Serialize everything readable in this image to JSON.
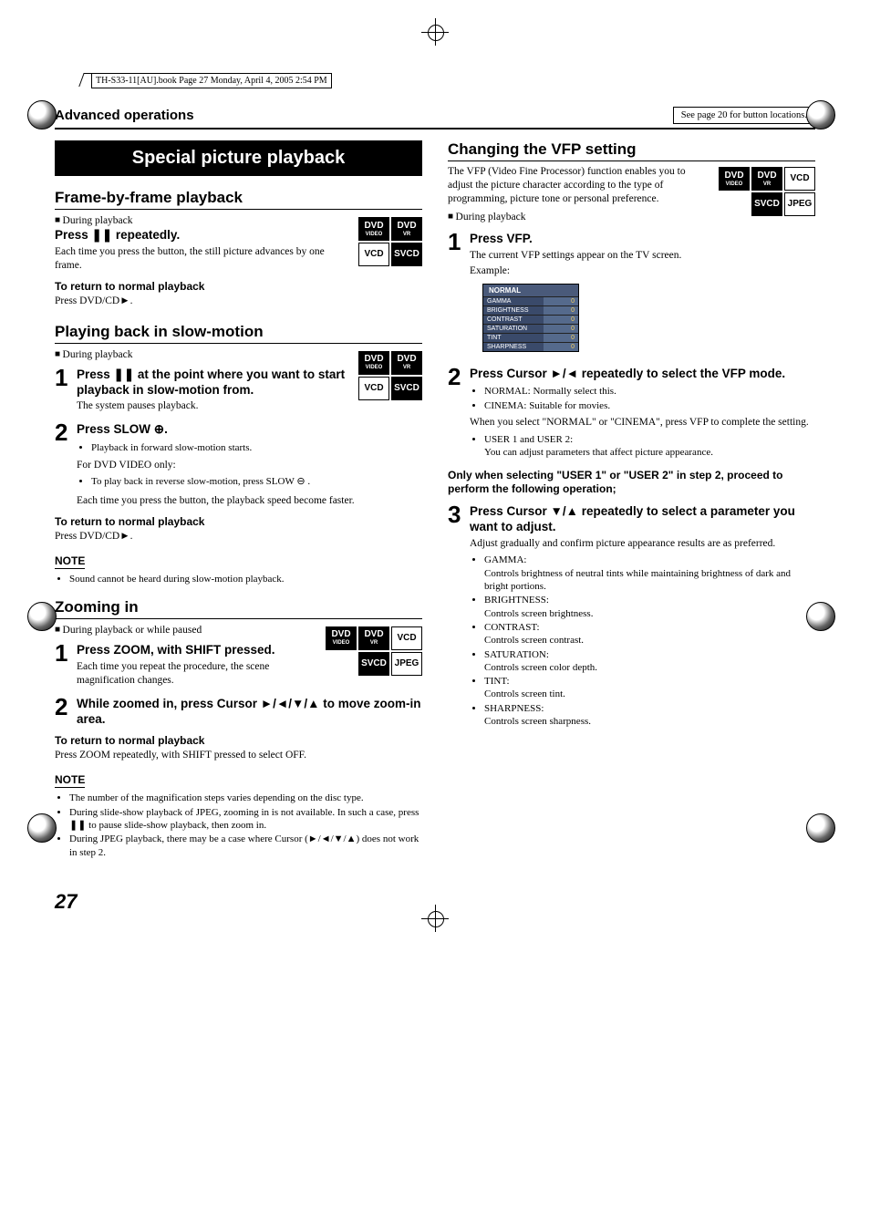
{
  "file_tag": "TH-S33-11[AU].book  Page 27  Monday, April 4, 2005  2:54 PM",
  "header": {
    "section": "Advanced operations",
    "button_note": "See page 20 for button locations."
  },
  "left": {
    "banner": "Special picture playback",
    "frame": {
      "title": "Frame-by-frame playback",
      "during": "During playback",
      "press_line": "Press ❚❚ repeatedly.",
      "desc": "Each time you press the button, the still picture advances by one frame.",
      "return_hd": "To return to normal playback",
      "return_body": "Press DVD/CD►.",
      "badges": [
        [
          "DVD",
          "VIDEO",
          "DVD",
          "VR"
        ],
        [
          "VCD",
          "",
          "SVCD",
          ""
        ]
      ]
    },
    "slow": {
      "title": "Playing back in slow-motion",
      "during": "During playback",
      "step1": "Press ❚❚ at the point where you want to start playback in slow-motion from.",
      "step1_sub": "The system pauses playback.",
      "step2": "Press SLOW ⊕.",
      "s2_b1": "Playback in forward slow-motion starts.",
      "s2_for": "For DVD VIDEO only:",
      "s2_b2": "To play back in reverse slow-motion, press SLOW ⊖ .",
      "s2_each": "Each time you press the button, the playback speed become faster.",
      "return_hd": "To return to normal playback",
      "return_body": "Press DVD/CD►.",
      "note_hd": "NOTE",
      "note1": "Sound cannot be heard during slow-motion playback.",
      "badges": [
        [
          "DVD",
          "VIDEO",
          "DVD",
          "VR"
        ],
        [
          "VCD",
          "",
          "SVCD",
          ""
        ]
      ]
    },
    "zoom": {
      "title": "Zooming in",
      "during": "During playback or while paused",
      "step1": "Press ZOOM, with SHIFT pressed.",
      "step1_sub": "Each time you repeat the procedure, the scene magnification changes.",
      "step2": "While zoomed in, press Cursor ►/◄/▼/▲ to move zoom-in area.",
      "return_hd": "To return to normal playback",
      "return_body": "Press ZOOM repeatedly, with SHIFT pressed to select OFF.",
      "note_hd": "NOTE",
      "note1": "The number of the magnification steps varies depending on the disc type.",
      "note2": "During slide-show playback of JPEG, zooming in is not available. In such a case, press ❚❚ to pause slide-show playback, then zoom in.",
      "note3": "During JPEG playback, there may be a case where Cursor (►/◄/▼/▲) does not work in step 2.",
      "badges": [
        [
          "DVD",
          "VIDEO",
          "DVD",
          "VR",
          "VCD",
          ""
        ],
        [
          "SVCD",
          "",
          "JPEG",
          ""
        ]
      ]
    }
  },
  "right": {
    "title": "Changing the VFP setting",
    "intro": "The VFP (Video Fine Processor) function enables you to adjust the picture character according to the type of programming, picture tone or personal preference.",
    "during": "During playback",
    "badges": [
      [
        "DVD",
        "VIDEO",
        "DVD",
        "VR",
        "VCD",
        ""
      ],
      [
        "SVCD",
        "",
        "JPEG",
        ""
      ]
    ],
    "step1": "Press VFP.",
    "step1_sub": "The current VFP settings appear on the TV screen.",
    "example": "Example:",
    "vfp_table": {
      "header": "NORMAL",
      "rows": [
        {
          "label": "GAMMA",
          "value": "0"
        },
        {
          "label": "BRIGHTNESS",
          "value": "0"
        },
        {
          "label": "CONTRAST",
          "value": "0"
        },
        {
          "label": "SATURATION",
          "value": "0"
        },
        {
          "label": "TINT",
          "value": "0"
        },
        {
          "label": "SHARPNESS",
          "value": "0"
        }
      ]
    },
    "step2": "Press Cursor ►/◄ repeatedly to select the VFP mode.",
    "s2_b1": "NORMAL: Normally select this.",
    "s2_b2": "CINEMA:  Suitable for movies.",
    "s2_when": "When you select \"NORMAL\" or \"CINEMA\", press VFP to complete the setting.",
    "s2_b3": "USER 1 and USER 2:",
    "s2_b3s": "You can adjust parameters that affect picture appearance.",
    "only_when": "Only when selecting \"USER 1\" or \"USER 2\" in step 2, proceed to perform the following operation;",
    "step3": "Press Cursor ▼/▲ repeatedly to select a parameter you want to adjust.",
    "s3_sub": "Adjust gradually and confirm picture appearance results are as preferred.",
    "params": [
      {
        "name": "GAMMA:",
        "desc": "Controls brightness of neutral tints while maintaining brightness of dark and bright portions."
      },
      {
        "name": "BRIGHTNESS:",
        "desc": "Controls screen brightness."
      },
      {
        "name": "CONTRAST:",
        "desc": "Controls screen contrast."
      },
      {
        "name": "SATURATION:",
        "desc": "Controls screen color depth."
      },
      {
        "name": "TINT:",
        "desc": "Controls screen tint."
      },
      {
        "name": "SHARPNESS:",
        "desc": "Controls screen sharpness."
      }
    ]
  },
  "page_num": "27"
}
